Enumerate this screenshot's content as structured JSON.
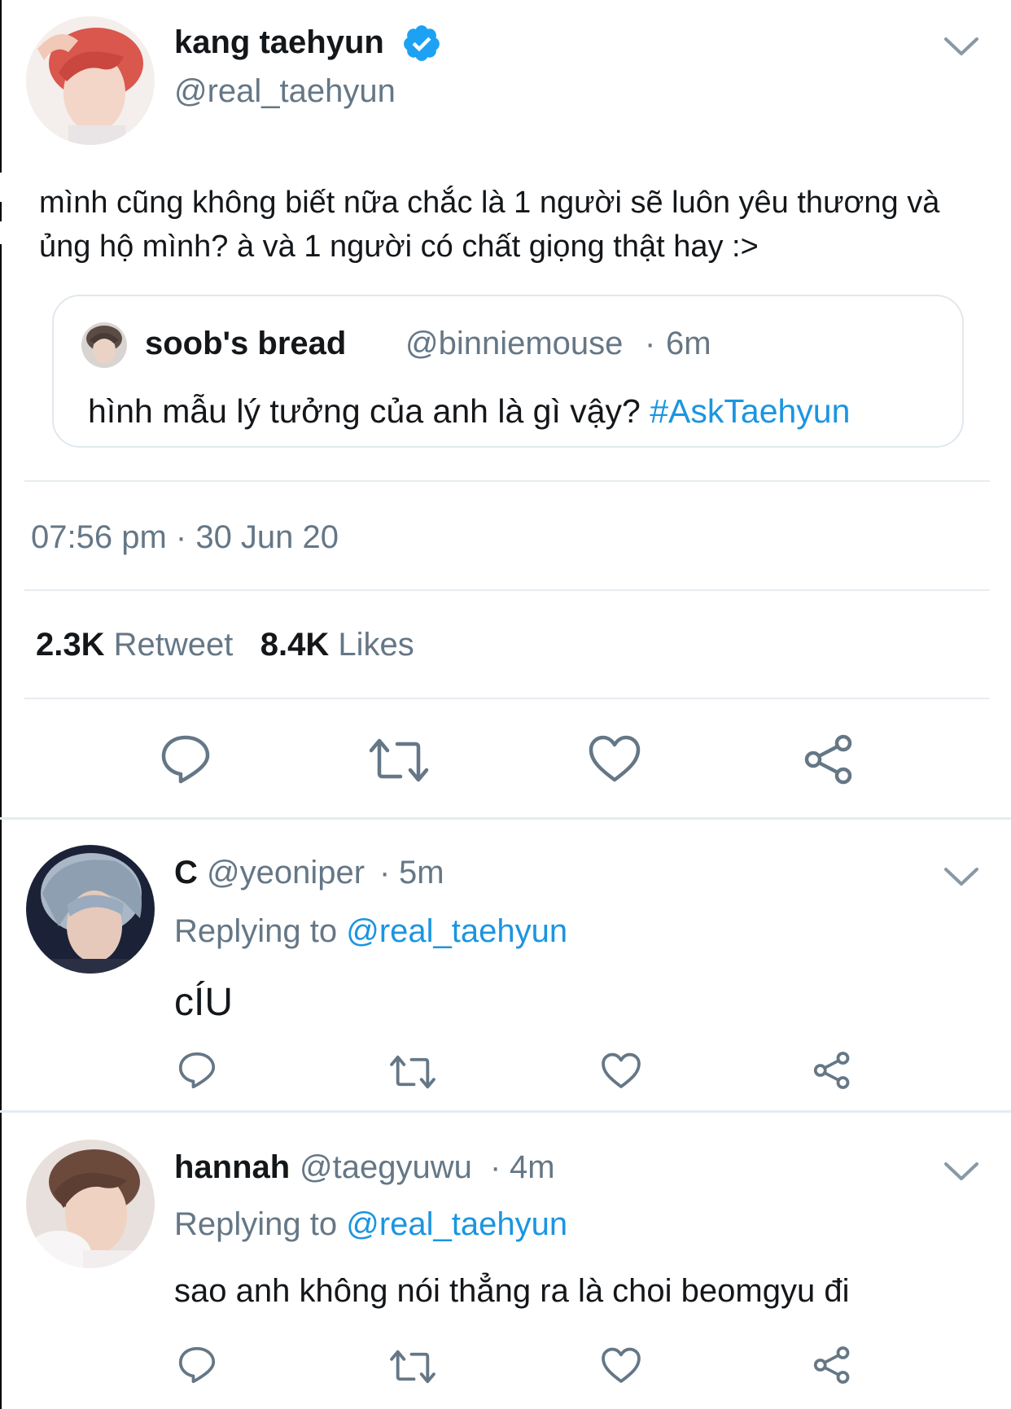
{
  "colors": {
    "text_primary": "#14171a",
    "text_secondary": "#657786",
    "link": "#1b95e0",
    "verified": "#1da1f2",
    "divider": "#e6ecf0"
  },
  "main_tweet": {
    "display_name": "kang taehyun",
    "handle": "@real_taehyun",
    "verified": true,
    "text_line1": "mình cũng không biết nữa chắc là 1 người sẽ luôn yêu thương và",
    "text_line2": "ủng hộ mình? à và 1 người có chất giọng thật hay :>",
    "quoted": {
      "display_name": "soob's bread",
      "handle": "@binniemouse",
      "separator": "·",
      "time": "6m",
      "text": "hình mẫu lý tưởng của anh là gì vậy?",
      "hashtag": "#AskTaehyun"
    },
    "timestamp": "07:56 pm · 30 Jun 20",
    "retweet_count": "2.3K",
    "retweet_label": "Retweet",
    "like_count": "8.4K",
    "like_label": "Likes"
  },
  "replies": [
    {
      "display_name": "C",
      "handle": "@yeoniper",
      "separator": "·",
      "time": "5m",
      "replying_prefix": "Replying to",
      "replying_to": "@real_taehyun",
      "text": "cÍU"
    },
    {
      "display_name": "hannah",
      "handle": "@taegyuwu",
      "separator": "·",
      "time": "4m",
      "replying_prefix": "Replying to",
      "replying_to": "@real_taehyun",
      "text": "sao anh không nói thẳng ra là choi beomgyu đi"
    }
  ],
  "icons": [
    "chevron-down-icon",
    "verified-badge-icon",
    "reply-icon",
    "retweet-icon",
    "like-icon",
    "share-icon"
  ]
}
